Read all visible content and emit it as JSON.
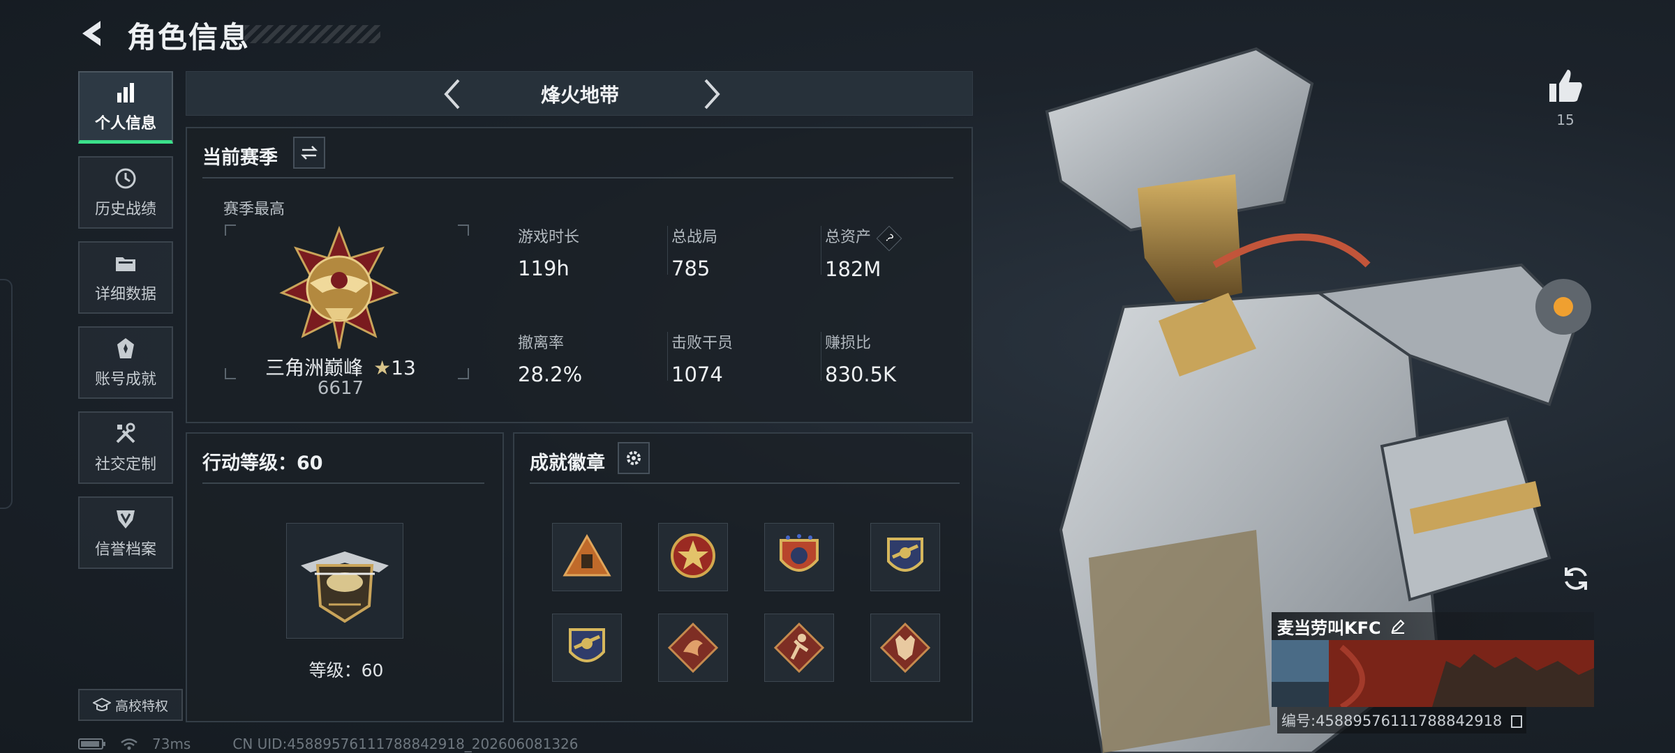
{
  "header": {
    "title": "角色信息"
  },
  "nav": [
    {
      "label": "个人信息",
      "icon": "bar-chart-icon",
      "active": true
    },
    {
      "label": "历史战绩",
      "icon": "history-icon"
    },
    {
      "label": "详细数据",
      "icon": "folder-icon"
    },
    {
      "label": "账号成就",
      "icon": "achievement-icon"
    },
    {
      "label": "社交定制",
      "icon": "tools-icon"
    },
    {
      "label": "信誉档案",
      "icon": "shield-icon"
    }
  ],
  "campus_button": {
    "label": "高校特权"
  },
  "status_bar": {
    "ping": "73ms",
    "uid": "CN UID:4588957611178884291​8_202606081326"
  },
  "mode_selector": {
    "title": "烽火地带"
  },
  "season": {
    "title": "当前赛季",
    "best_label": "赛季最高",
    "rank_name": "三角洲巅峰",
    "rank_stars": "13",
    "rank_score": "6617",
    "stats": [
      {
        "label": "游戏时长",
        "value": "119h"
      },
      {
        "label": "总战局",
        "value": "785"
      },
      {
        "label": "总资产",
        "value": "182M",
        "help": "?"
      },
      {
        "label": "撤离率",
        "value": "28.2%"
      },
      {
        "label": "击败干员",
        "value": "1074"
      },
      {
        "label": "赚损比",
        "value": "830.5K"
      }
    ]
  },
  "level": {
    "title": "行动等级：60",
    "caption": "等级：60"
  },
  "achievements": {
    "title": "成就徽章",
    "badges": [
      "triangle-emblem-icon",
      "star-emblem-icon",
      "crest-emblem-icon",
      "wing-emblem-icon",
      "wing-emblem-icon",
      "dragon-emblem-icon",
      "runner-emblem-icon",
      "wolf-emblem-icon"
    ]
  },
  "profile": {
    "likes": "15",
    "name": "麦当劳叫KFC",
    "id": "编号:4588957611178884291​8"
  },
  "colors": {
    "accent": "#3be08a",
    "panel_border": "#343e47",
    "gold": "#c9a45a"
  }
}
